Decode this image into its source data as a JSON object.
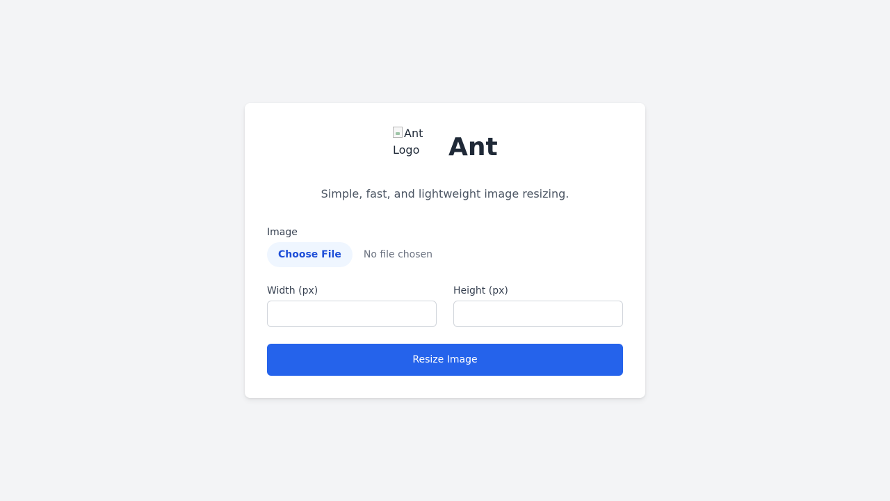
{
  "app": {
    "logo_alt": "Ant Logo",
    "title": "Ant",
    "subtitle": "Simple, fast, and lightweight image resizing."
  },
  "form": {
    "image_label": "Image",
    "choose_file_label": "Choose File",
    "file_status": "No file chosen",
    "width_label": "Width (px)",
    "width_value": "",
    "height_label": "Height (px)",
    "height_value": "",
    "submit_label": "Resize Image"
  },
  "colors": {
    "background": "#f3f4f6",
    "card": "#ffffff",
    "accent": "#2563eb",
    "file_button_bg": "#eff6ff",
    "file_button_text": "#1d4ed8"
  }
}
